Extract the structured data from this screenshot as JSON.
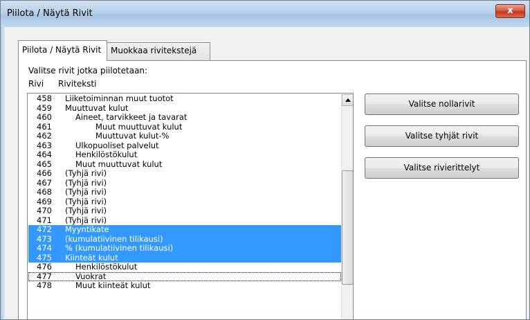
{
  "window": {
    "title": "Piilota / Näytä Rivit",
    "close_glyph": "x"
  },
  "tabs": [
    {
      "label": "Piilota / Näytä Rivit",
      "active": true
    },
    {
      "label": "Muokkaa rivitekstejä",
      "active": false
    }
  ],
  "panel": {
    "instruction": "Valitse rivit jotka piilotetaan:",
    "col_row": "Rivi",
    "col_text": "Riviteksti"
  },
  "list": {
    "rows": [
      {
        "num": "458",
        "text": "Liiketoiminnan muut tuotot",
        "indent": 0,
        "selected": false
      },
      {
        "num": "459",
        "text": "Muuttuvat kulut",
        "indent": 0,
        "selected": false
      },
      {
        "num": "460",
        "text": "Aineet, tarvikkeet ja tavarat",
        "indent": 1,
        "selected": false
      },
      {
        "num": "461",
        "text": "Muut muuttuvat kulut",
        "indent": 2,
        "selected": false
      },
      {
        "num": "462",
        "text": "Muuttuvat kulut-%",
        "indent": 2,
        "selected": false
      },
      {
        "num": "463",
        "text": "Ulkopuoliset palvelut",
        "indent": 1,
        "selected": false
      },
      {
        "num": "464",
        "text": "Henkilöstökulut",
        "indent": 1,
        "selected": false
      },
      {
        "num": "465",
        "text": "Muut muuttuvat kulut",
        "indent": 1,
        "selected": false
      },
      {
        "num": "466",
        "text": "(Tyhjä rivi)",
        "indent": 0,
        "selected": false
      },
      {
        "num": "467",
        "text": "(Tyhjä rivi)",
        "indent": 0,
        "selected": false
      },
      {
        "num": "468",
        "text": "(Tyhjä rivi)",
        "indent": 0,
        "selected": false
      },
      {
        "num": "469",
        "text": "(Tyhjä rivi)",
        "indent": 0,
        "selected": false
      },
      {
        "num": "470",
        "text": "(Tyhjä rivi)",
        "indent": 0,
        "selected": false
      },
      {
        "num": "471",
        "text": "(Tyhjä rivi)",
        "indent": 0,
        "selected": false
      },
      {
        "num": "472",
        "text": "Myyntikate",
        "indent": 0,
        "selected": true
      },
      {
        "num": "473",
        "text": "(kumulatiivinen tilikausi)",
        "indent": 0,
        "selected": true
      },
      {
        "num": "474",
        "text": "% (kumulatiivinen tilikausi)",
        "indent": 0,
        "selected": true
      },
      {
        "num": "475",
        "text": "Kiinteät kulut",
        "indent": 0,
        "selected": true
      },
      {
        "num": "476",
        "text": "Henkilöstökulut",
        "indent": 1,
        "selected": false
      },
      {
        "num": "477",
        "text": "Vuokrat",
        "indent": 1,
        "selected": false,
        "focused": true
      },
      {
        "num": "478",
        "text": "Muut kiinteät kulut",
        "indent": 1,
        "selected": false
      }
    ]
  },
  "buttons": {
    "select_zero": "Valitse nollarivit",
    "select_empty": "Valitse tyhjät rivit",
    "select_breakdowns": "Valitse rivierittelyt"
  }
}
